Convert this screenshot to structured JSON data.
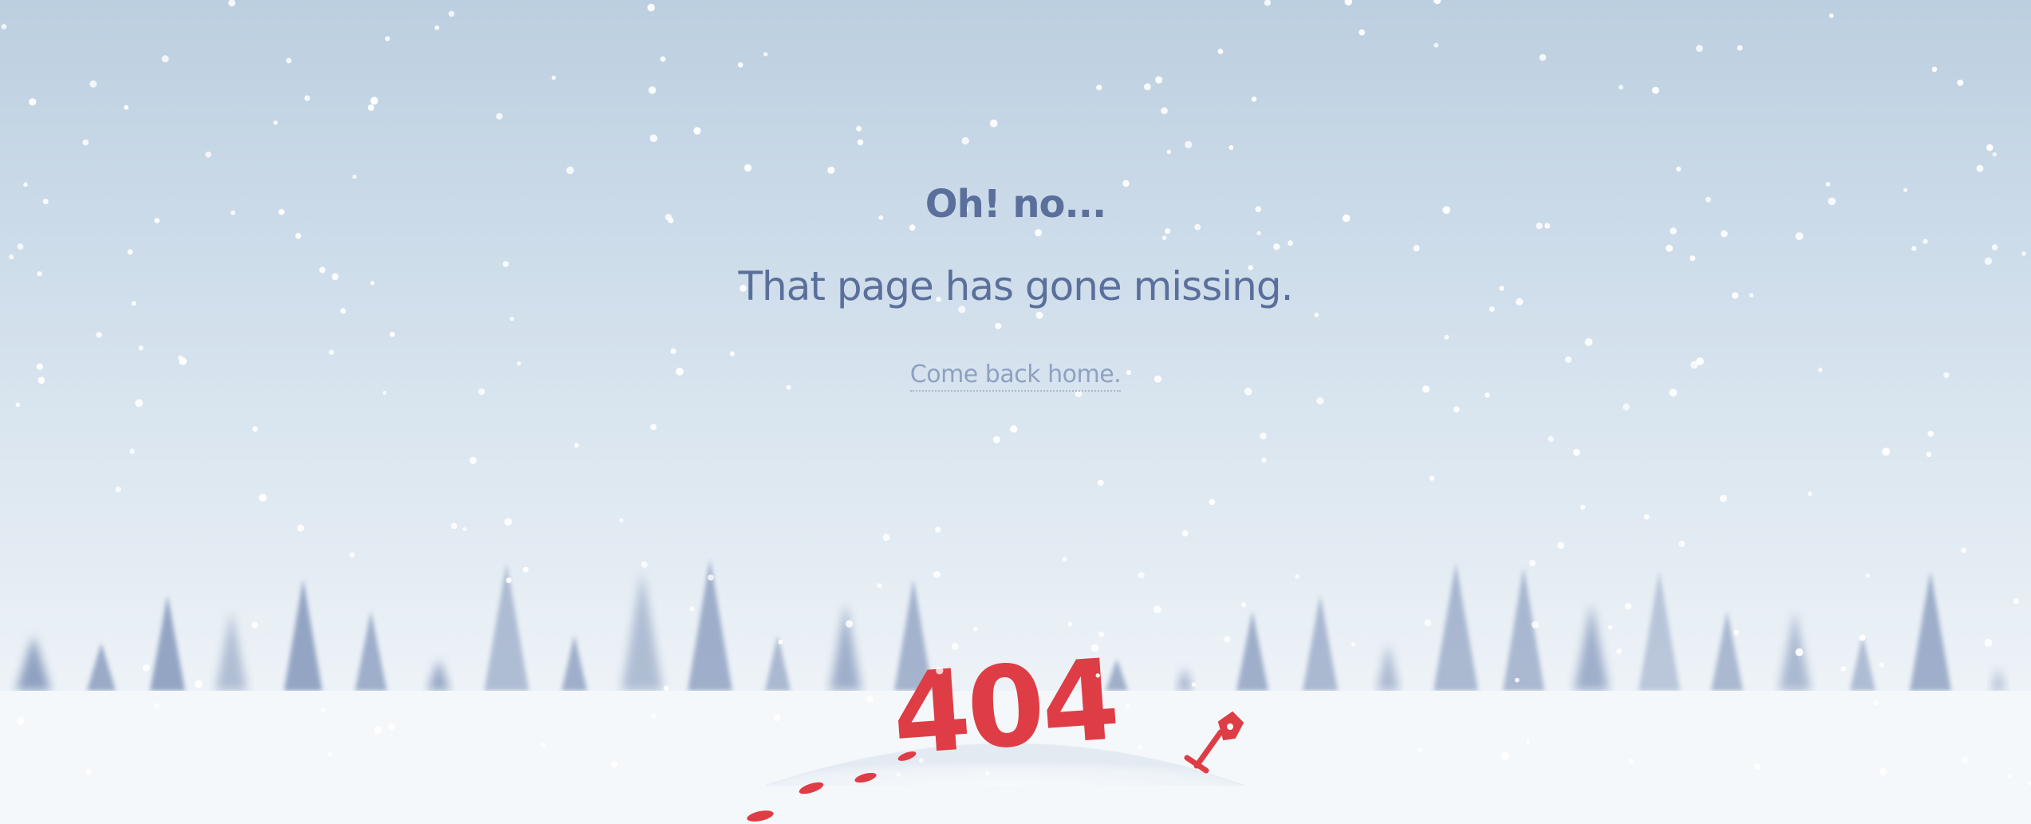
{
  "message": {
    "headline": "Oh! no...",
    "subline": "That page has gone missing.",
    "home_link": "Come back home."
  },
  "sign": {
    "text": "404"
  },
  "colors": {
    "text_primary": "#5a6f9b",
    "link": "#8ea1c2",
    "accent_red": "#de3d45",
    "tree": "#7f93b8",
    "snow": "#ffffff"
  },
  "icons": {
    "shovel": "shovel-icon"
  }
}
